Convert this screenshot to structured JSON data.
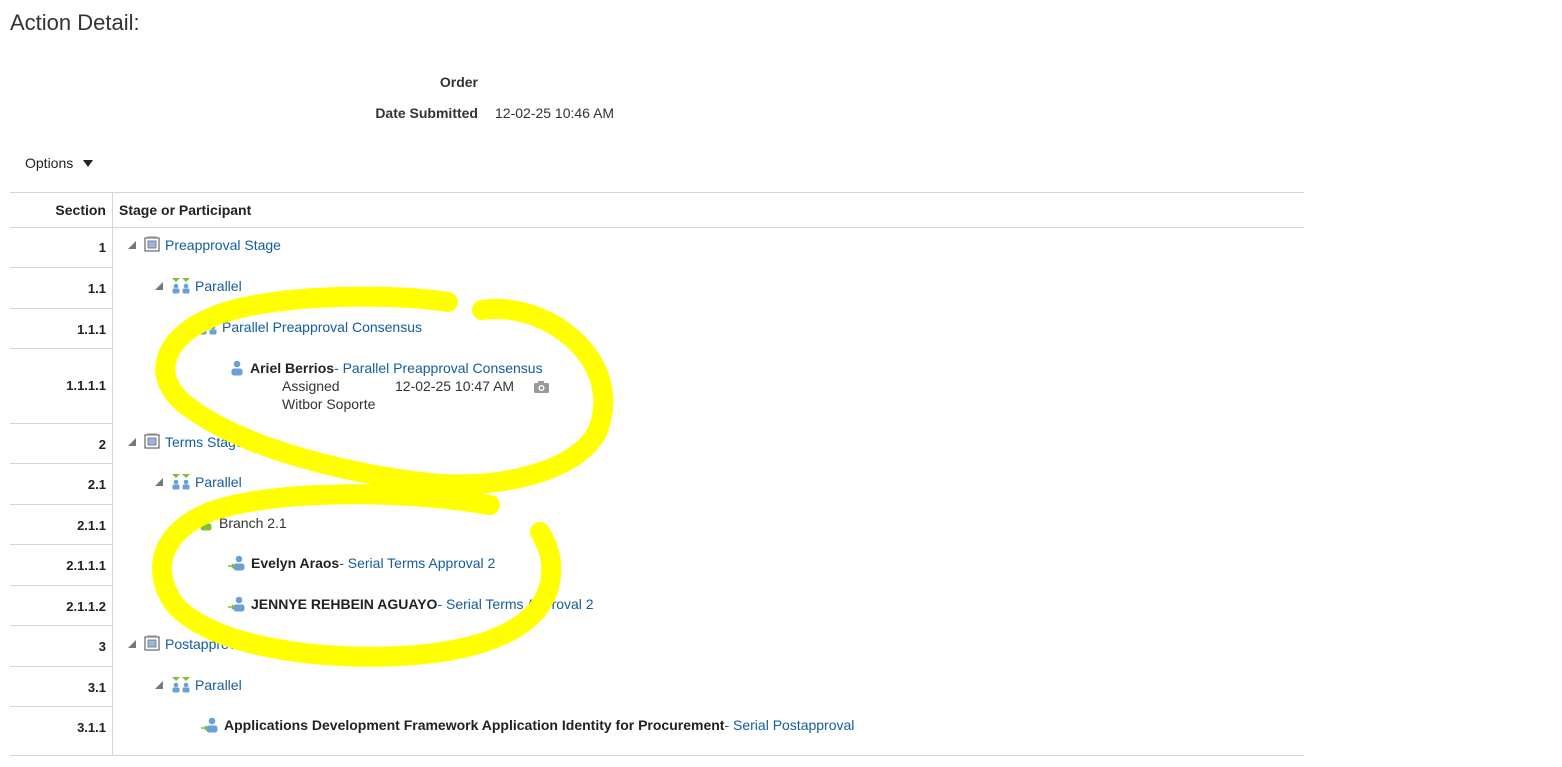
{
  "page": {
    "title": "Action Detail:"
  },
  "meta": {
    "order_label": "Order",
    "date_label": "Date Submitted",
    "date_value": "12-02-25 10:46 AM"
  },
  "options": {
    "label": "Options"
  },
  "table": {
    "headers": {
      "section": "Section",
      "stage": "Stage or Participant"
    },
    "rows": [
      {
        "section": "1",
        "type": "stage",
        "label": "Preapproval Stage",
        "icon": "stage-icon"
      },
      {
        "section": "1.1",
        "type": "parallel",
        "label": "Parallel",
        "icon": "parallel-icon"
      },
      {
        "section": "1.1.1",
        "type": "parallel",
        "label": "Parallel Preapproval Consensus",
        "icon": "parallel-icon"
      },
      {
        "section": "1.1.1.1",
        "type": "participant",
        "name": "Ariel Berrios",
        "rule": " - Parallel Preapproval Consensus",
        "status": "Assigned",
        "time": "12-02-25 10:47 AM",
        "org": "Witbor Soporte",
        "icon": "user-icon"
      },
      {
        "section": "2",
        "type": "stage",
        "label": "Terms Stage",
        "icon": "stage-icon"
      },
      {
        "section": "2.1",
        "type": "parallel",
        "label": "Parallel",
        "icon": "parallel-icon"
      },
      {
        "section": "2.1.1",
        "type": "branch",
        "label": "Branch 2.1",
        "icon": "branch-user-icon"
      },
      {
        "section": "2.1.1.1",
        "type": "participant",
        "name": "Evelyn Araos",
        "rule": " - Serial Terms Approval 2",
        "icon": "user-arrow-icon"
      },
      {
        "section": "2.1.1.2",
        "type": "participant",
        "name": "JENNYE REHBEIN AGUAYO",
        "rule": " - Serial Terms Approval 2",
        "icon": "user-arrow-icon"
      },
      {
        "section": "3",
        "type": "stage",
        "label": "Postapproval Stage",
        "icon": "stage-icon"
      },
      {
        "section": "3.1",
        "type": "parallel",
        "label": "Parallel",
        "icon": "parallel-icon"
      },
      {
        "section": "3.1.1",
        "type": "participant",
        "name": "Applications Development Framework Application Identity for Procurement",
        "rule": " - Serial Postapproval",
        "icon": "user-arrow-icon"
      }
    ]
  },
  "colors": {
    "link": "#145c9e",
    "highlight": "#ffff00",
    "grid": "#d6d6d6"
  }
}
